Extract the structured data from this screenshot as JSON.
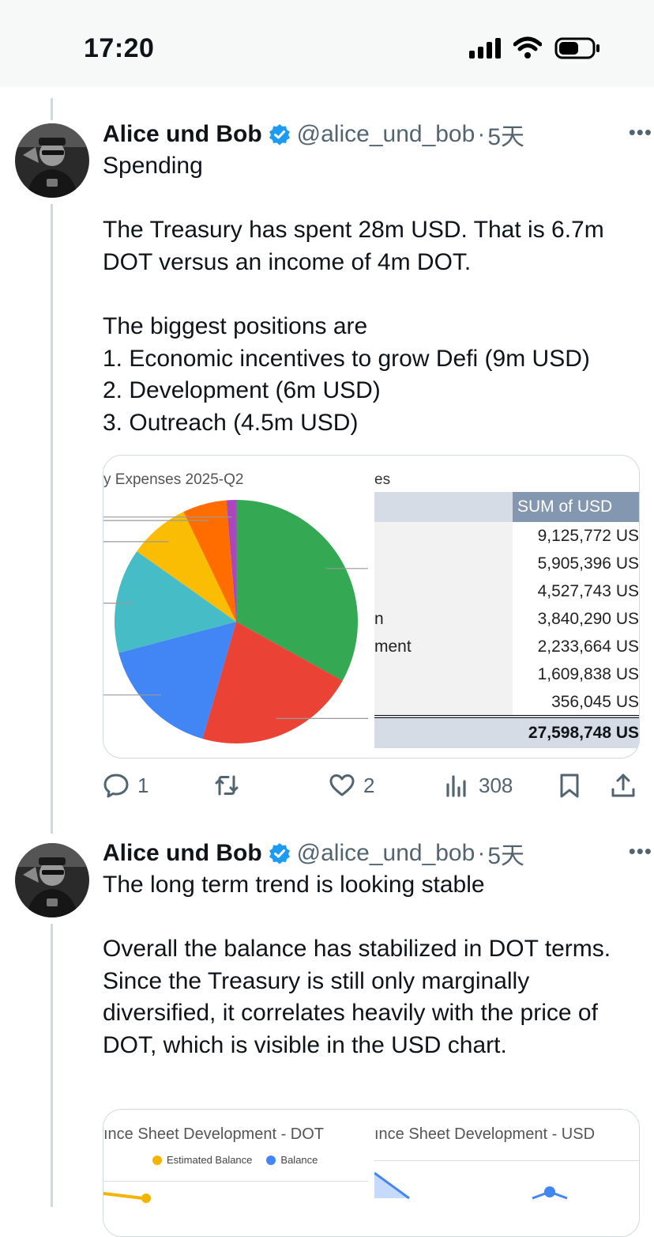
{
  "status_bar": {
    "time": "17:20"
  },
  "tweets": [
    {
      "name": "Alice und Bob",
      "handle": "@alice_und_bob",
      "separator": "·",
      "age": "5天",
      "more": "•••",
      "text": "Spending\n\nThe Treasury has spent 28m USD. That is 6.7m DOT versus an income of 4m DOT.\n\nThe biggest positions are\n1. Economic incentives to grow Defi (9m USD)\n2. Development (6m USD)\n3. Outreach (4.5m USD)",
      "media": {
        "chart_title": "y Expenses 2025-Q2",
        "table_title": "es",
        "table_header": "SUM of USD",
        "rows": [
          {
            "label": "",
            "value": "9,125,772 US"
          },
          {
            "label": "",
            "value": "5,905,396 US"
          },
          {
            "label": "",
            "value": "4,527,743 US"
          },
          {
            "label": "n",
            "value": "3,840,290 US"
          },
          {
            "label": "ment",
            "value": "2,233,664 US"
          },
          {
            "label": "",
            "value": "1,609,838 US"
          },
          {
            "label": "",
            "value": "356,045 US"
          }
        ],
        "total": "27,598,748 US"
      },
      "actions": {
        "replies": "1",
        "reposts": "",
        "likes": "2",
        "views": "308"
      }
    },
    {
      "name": "Alice und Bob",
      "handle": "@alice_und_bob",
      "separator": "·",
      "age": "5天",
      "more": "•••",
      "text": "The long term trend is looking stable\n\nOverall the balance has stabilized in DOT terms. Since the Treasury is still only marginally diversified, it correlates heavily with the price of DOT, which is visible in the USD chart.",
      "media": {
        "left_title": "ınce Sheet Development - DOT",
        "legend": [
          "Estimated Balance",
          "Balance"
        ],
        "right_title": "ınce Sheet Development - USD"
      }
    }
  ],
  "chart_data": {
    "type": "pie",
    "title": "y Expenses 2025-Q2",
    "categories": [
      "",
      "",
      "",
      "",
      "",
      "",
      ""
    ],
    "values": [
      9125772,
      5905396,
      4527743,
      3840290,
      2233664,
      1609838,
      356045
    ],
    "colors": [
      "#34a853",
      "#ea4335",
      "#4285f4",
      "#46bdc6",
      "#fbbc04",
      "#ff6d01",
      "#ab47bc"
    ]
  }
}
